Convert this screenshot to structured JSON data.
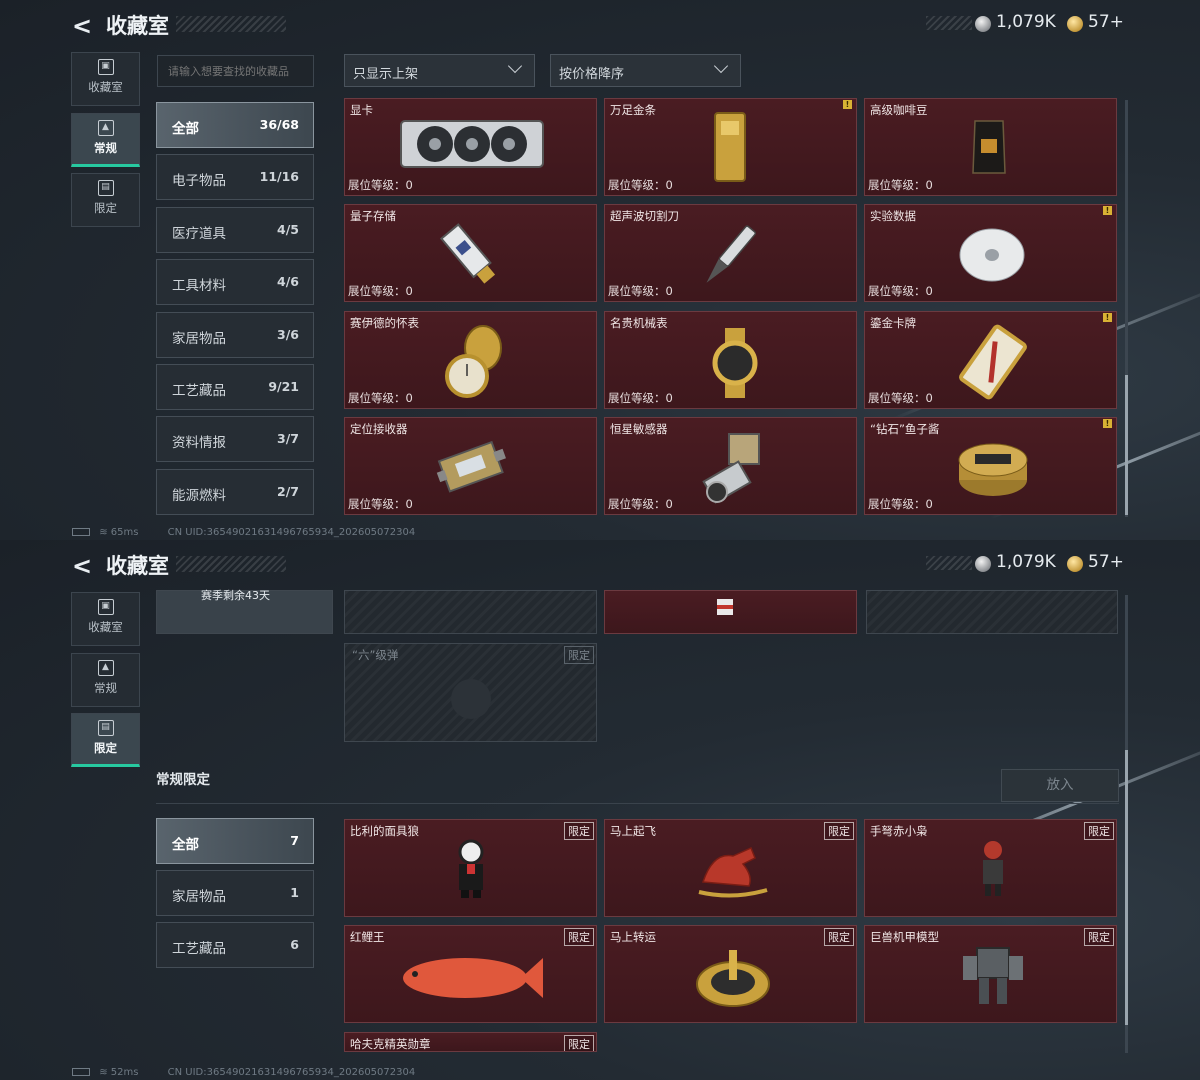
{
  "header": {
    "title": "收藏室",
    "silver": "1,079K",
    "gold": "57+"
  },
  "nav": {
    "items": [
      "收藏室",
      "常规",
      "限定"
    ]
  },
  "top": {
    "search_placeholder": "请输入想要查找的收藏品",
    "filter1": "只显示上架",
    "filter2": "按价格降序",
    "categories": [
      {
        "name": "全部",
        "count": "36/68"
      },
      {
        "name": "电子物品",
        "count": "11/16"
      },
      {
        "name": "医疗道具",
        "count": "4/5"
      },
      {
        "name": "工具材料",
        "count": "4/6"
      },
      {
        "name": "家居物品",
        "count": "3/6"
      },
      {
        "name": "工艺藏品",
        "count": "9/21"
      },
      {
        "name": "资料情报",
        "count": "3/7"
      },
      {
        "name": "能源燃料",
        "count": "2/7"
      }
    ],
    "level_label": "展位等级：0",
    "items": [
      {
        "name": "显卡"
      },
      {
        "name": "万足金条"
      },
      {
        "name": "高级咖啡豆"
      },
      {
        "name": "量子存储"
      },
      {
        "name": "超声波切割刀"
      },
      {
        "name": "实验数据"
      },
      {
        "name": "赛伊德的怀表"
      },
      {
        "name": "名贵机械表"
      },
      {
        "name": "鎏金卡牌"
      },
      {
        "name": "定位接收器"
      },
      {
        "name": "恒星敏感器"
      },
      {
        "name": "“钻石”鱼子酱"
      }
    ],
    "status_ping": "65ms",
    "status_uid": "CN UID:3654902163149676593​4_202605072304"
  },
  "bottom": {
    "partial_text": "赛季剩余43天",
    "grey_card": {
      "name": "“六”级弹",
      "tag": "限定"
    },
    "section_title": "常规限定",
    "put_button": "放入",
    "categories": [
      {
        "name": "全部",
        "count": "7"
      },
      {
        "name": "家居物品",
        "count": "1"
      },
      {
        "name": "工艺藏品",
        "count": "6"
      }
    ],
    "tag": "限定",
    "items": [
      {
        "name": "比利的面具狼"
      },
      {
        "name": "马上起飞"
      },
      {
        "name": "手弩赤小枭"
      },
      {
        "name": "红鲤王"
      },
      {
        "name": "马上转运"
      },
      {
        "name": "巨兽机甲模型"
      },
      {
        "name": "哈夫克精英勋章"
      }
    ],
    "status_ping": "52ms",
    "status_uid": "CN UID:36549021631496765934_202605072304"
  }
}
